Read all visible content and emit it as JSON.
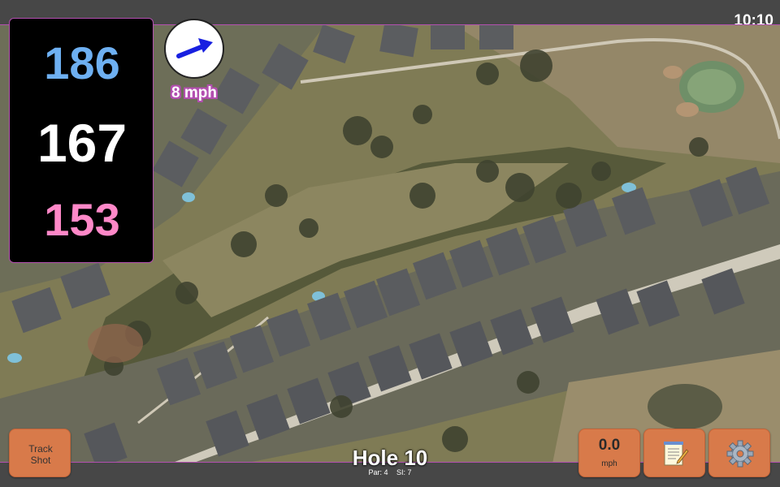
{
  "status_bar": {
    "time": "10:10"
  },
  "distances": {
    "back": "186",
    "middle": "167",
    "front": "153"
  },
  "wind": {
    "speed": "8 mph",
    "direction_icon": "wind-arrow-icon"
  },
  "hole": {
    "title": "Hole 10",
    "par": "Par: 4",
    "stroke_index": "SI: 7"
  },
  "buttons": {
    "track_shot": "Track Shot",
    "speed_value": "0.0",
    "speed_unit": "mph",
    "notes_icon": "notepad-icon",
    "settings_icon": "gear-icon"
  },
  "colors": {
    "accent_border": "#b34fb0",
    "button_orange": "#d87a4a",
    "back_distance": "#6eb0f2",
    "middle_distance": "#ffffff",
    "front_distance": "#ff88c8"
  }
}
